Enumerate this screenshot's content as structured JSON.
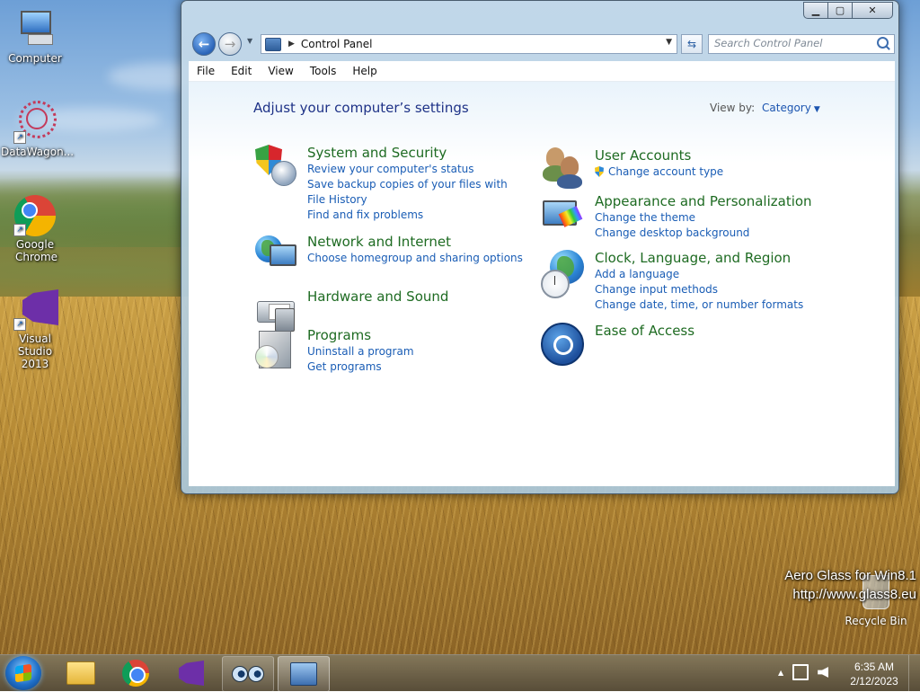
{
  "desktop": {
    "icons": [
      {
        "label": "Computer"
      },
      {
        "label": "DataWagon..."
      },
      {
        "label": "Google Chrome"
      },
      {
        "label": "Visual Studio 2013"
      }
    ],
    "watermark": {
      "line1": "Aero Glass for Win8.1",
      "line2": "http://www.glass8.eu"
    },
    "recycle_bin": "Recycle Bin"
  },
  "window": {
    "address_crumb": "Control Panel",
    "search_placeholder": "Search Control Panel",
    "menu": [
      "File",
      "Edit",
      "View",
      "Tools",
      "Help"
    ],
    "heading": "Adjust your computer’s settings",
    "view_by_label": "View by:",
    "view_by_value": "Category",
    "categories_left": [
      {
        "title": "System and Security",
        "links": [
          "Review your computer's status",
          "Save backup copies of your files with File History",
          "Find and fix problems"
        ]
      },
      {
        "title": "Network and Internet",
        "links": [
          "Choose homegroup and sharing options"
        ]
      },
      {
        "title": "Hardware and Sound",
        "links": []
      },
      {
        "title": "Programs",
        "links": [
          "Uninstall a program",
          "Get programs"
        ]
      }
    ],
    "categories_right": [
      {
        "title": "User Accounts",
        "links": [
          "Change account type"
        ]
      },
      {
        "title": "Appearance and Personalization",
        "links": [
          "Change the theme",
          "Change desktop background"
        ]
      },
      {
        "title": "Clock, Language, and Region",
        "links": [
          "Add a language",
          "Change input methods",
          "Change date, time, or number formats"
        ]
      },
      {
        "title": "Ease of Access",
        "links": []
      }
    ]
  },
  "taskbar": {
    "apps": [
      "file-explorer",
      "google-chrome",
      "visual-studio",
      "eyes-app",
      "control-panel"
    ],
    "time": "6:35 AM",
    "date": "2/12/2023"
  }
}
